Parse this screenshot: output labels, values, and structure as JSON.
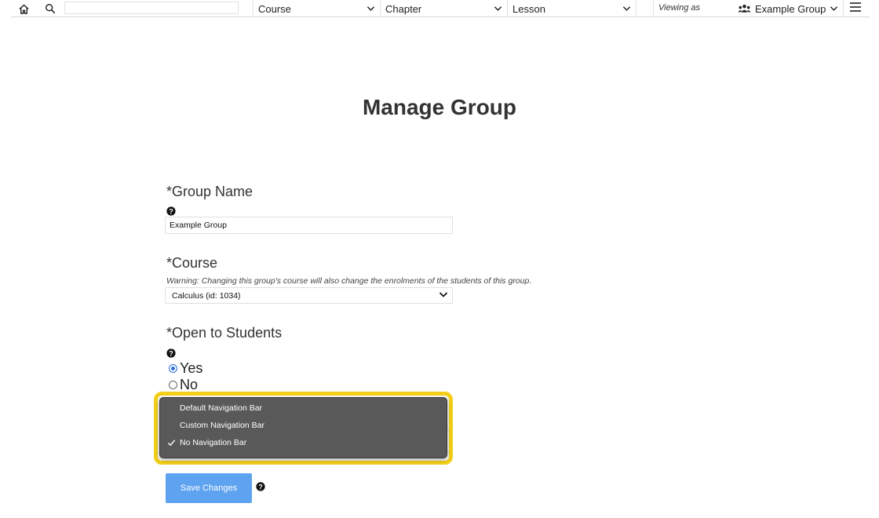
{
  "topbar": {
    "icons": {
      "home": "home-icon",
      "search": "search-icon",
      "menu": "hamburger-menu-icon",
      "group": "group-users-icon"
    },
    "search_value": "",
    "course_label": "Course",
    "chapter_label": "Chapter",
    "lesson_label": "Lesson",
    "viewing_as_label": "Viewing as",
    "group_label": "Example Group"
  },
  "page": {
    "title": "Manage Group"
  },
  "form": {
    "group_name": {
      "label": "*Group Name",
      "value": "Example Group"
    },
    "course": {
      "label": "*Course",
      "warning": "Warning: Changing this group's course will also change the enrolments of the students of this group.",
      "selected": "Calculus (id: 1034)"
    },
    "open_to_students": {
      "label": "*Open to Students",
      "options": [
        "Yes",
        "No"
      ],
      "selected": "Yes"
    },
    "navigation_bar": {
      "options": [
        "Default Navigation Bar",
        "Custom Navigation Bar",
        "No Navigation Bar"
      ],
      "selected": "No Navigation Bar"
    },
    "save_label": "Save Changes"
  },
  "colors": {
    "accent_button": "#5ea3ef",
    "highlight_border": "#f3cf1b",
    "radio_selected": "#2c72d8",
    "popup_background": "#525252"
  }
}
